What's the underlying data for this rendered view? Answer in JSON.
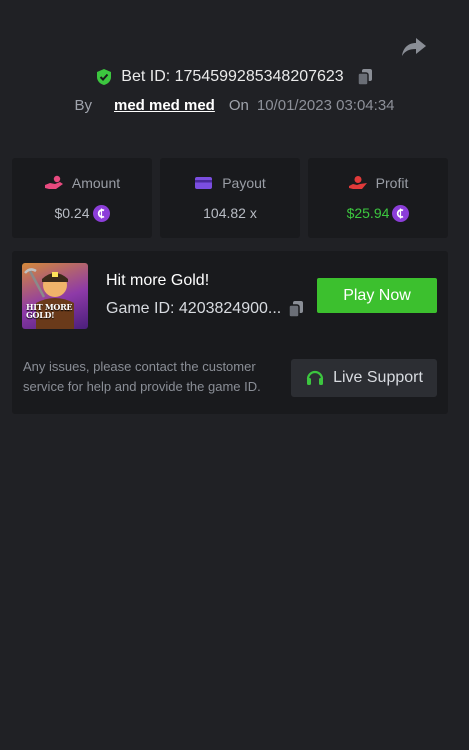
{
  "header": {
    "share_icon": "share-arrow-icon",
    "bet_id_label": "Bet ID: 1754599285348207623",
    "by_label": "By",
    "username": "med med med",
    "on_label": "On",
    "datetime": "10/01/2023 03:04:34"
  },
  "stats": {
    "amount": {
      "label": "Amount",
      "value": "$0.24",
      "icon": "hand-coin-icon",
      "icon_color": "#e84a7f"
    },
    "payout": {
      "label": "Payout",
      "value": "104.82 x",
      "icon": "wallet-card-icon",
      "icon_color": "#7b4ee0"
    },
    "profit": {
      "label": "Profit",
      "value": "$25.94",
      "icon": "hand-money-icon",
      "icon_color": "#e03a3a",
      "value_color": "#3cc63f"
    }
  },
  "game": {
    "title": "Hit more Gold!",
    "thumbnail_text": "HIT MORE GOLD!",
    "game_id_label": "Game ID: 4203824900...",
    "play_label": "Play Now",
    "issues_text": "Any issues, please contact the customer service for help and provide the game ID.",
    "support_label": "Live Support"
  },
  "colors": {
    "background": "#202125",
    "card": "#191a1d",
    "accent_green": "#3cc02e",
    "coin_purple": "#8c3ed9"
  }
}
